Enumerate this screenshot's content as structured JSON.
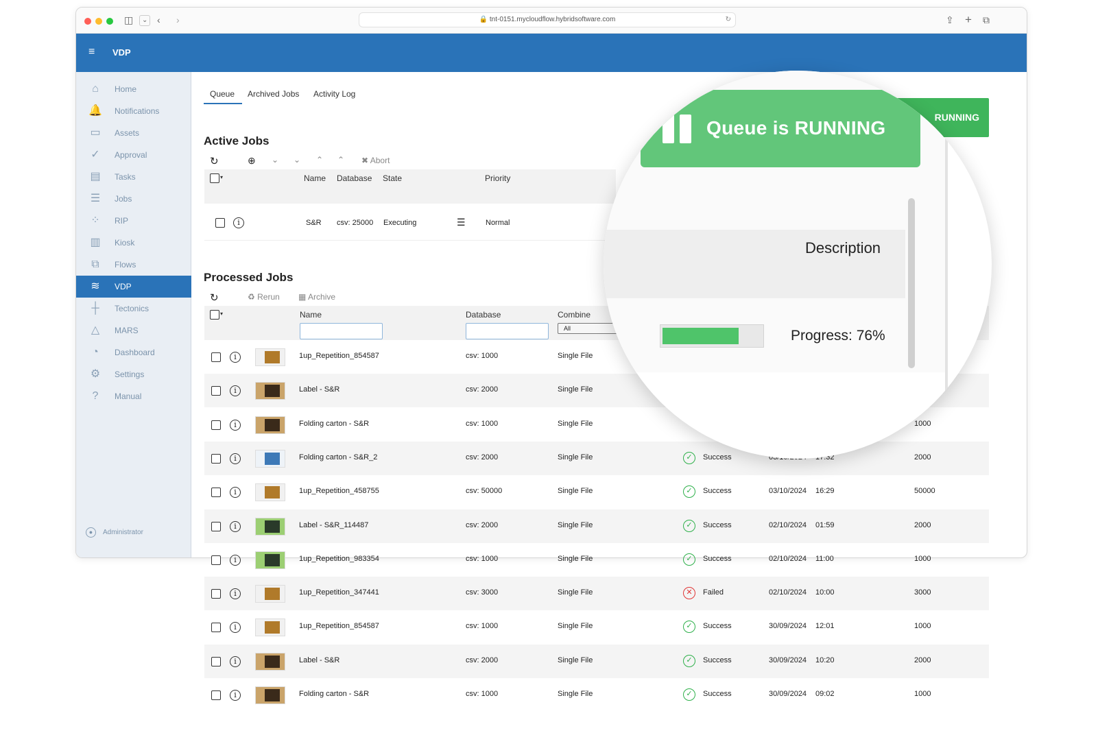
{
  "browser": {
    "url": "tnt-0151.mycloudflow.hybridsoftware.com"
  },
  "app": {
    "title": "VDP",
    "user": "Administrator"
  },
  "sidebar": {
    "items": [
      {
        "label": "Home",
        "icon": "home-icon",
        "glyph": "⌂"
      },
      {
        "label": "Notifications",
        "icon": "bell-icon",
        "glyph": "🔔"
      },
      {
        "label": "Assets",
        "icon": "tray-icon",
        "glyph": "▭"
      },
      {
        "label": "Approval",
        "icon": "check-circle-icon",
        "glyph": "✓"
      },
      {
        "label": "Tasks",
        "icon": "calendar-icon",
        "glyph": "▤"
      },
      {
        "label": "Jobs",
        "icon": "list-icon",
        "glyph": "☰"
      },
      {
        "label": "RIP",
        "icon": "dots-grid-icon",
        "glyph": "⁘"
      },
      {
        "label": "Kiosk",
        "icon": "kiosk-icon",
        "glyph": "▥"
      },
      {
        "label": "Flows",
        "icon": "flows-icon",
        "glyph": "⧉"
      },
      {
        "label": "VDP",
        "icon": "layers-icon",
        "glyph": "≋"
      },
      {
        "label": "Tectonics",
        "icon": "tectonics-icon",
        "glyph": "┼"
      },
      {
        "label": "MARS",
        "icon": "triangle-icon",
        "glyph": "△"
      },
      {
        "label": "Dashboard",
        "icon": "pie-icon",
        "glyph": "◔"
      },
      {
        "label": "Settings",
        "icon": "gear-icon",
        "glyph": "⚙"
      },
      {
        "label": "Manual",
        "icon": "help-icon",
        "glyph": "?"
      }
    ]
  },
  "tabs": [
    "Queue",
    "Archived Jobs",
    "Activity Log"
  ],
  "queue_status": "Queue is RUNNING",
  "queue_status_small": "RUNNING",
  "active": {
    "title": "Active Jobs",
    "abort": "Abort",
    "headers": [
      "Name",
      "Database",
      "State",
      "Priority"
    ],
    "job": {
      "name": "S&R",
      "database": "csv: 25000",
      "state": "Executing",
      "priority": "Normal"
    }
  },
  "zoom": {
    "description": "Description",
    "progress_label": "Progress: 76%",
    "progress": 0.76
  },
  "processed": {
    "title": "Processed Jobs",
    "rerun": "Rerun",
    "archive": "Archive",
    "headers": [
      "Name",
      "Database",
      "Combine"
    ],
    "combine_filter": "All",
    "rows": [
      {
        "name": "1up_Repetition_854587",
        "db": "csv: 1000",
        "combine": "Single File",
        "status": "",
        "date": "",
        "time": "",
        "count": "",
        "thumb": "tall"
      },
      {
        "name": "Label - S&R",
        "db": "csv: 2000",
        "combine": "Single File",
        "status": "",
        "date": "",
        "time": "",
        "count": "",
        "thumb": "label"
      },
      {
        "name": "Folding carton - S&R",
        "db": "csv: 1000",
        "combine": "Single File",
        "status": "",
        "date": "",
        "time": "",
        "count": "1000",
        "thumb": "label"
      },
      {
        "name": "Folding carton - S&R_2",
        "db": "csv: 2000",
        "combine": "Single File",
        "status": "Success",
        "date": "03/10/2024",
        "time": "17:32",
        "count": "2000",
        "thumb": "blue"
      },
      {
        "name": "1up_Repetition_458755",
        "db": "csv: 50000",
        "combine": "Single File",
        "status": "Success",
        "date": "03/10/2024",
        "time": "16:29",
        "count": "50000",
        "thumb": "tall"
      },
      {
        "name": "Label - S&R_114487",
        "db": "csv: 2000",
        "combine": "Single File",
        "status": "Success",
        "date": "02/10/2024",
        "time": "01:59",
        "count": "2000",
        "thumb": "green"
      },
      {
        "name": "1up_Repetition_983354",
        "db": "csv: 1000",
        "combine": "Single File",
        "status": "Success",
        "date": "02/10/2024",
        "time": "11:00",
        "count": "1000",
        "thumb": "green"
      },
      {
        "name": "1up_Repetition_347441",
        "db": "csv: 3000",
        "combine": "Single File",
        "status": "Failed",
        "date": "02/10/2024",
        "time": "10:00",
        "count": "3000",
        "thumb": "tall"
      },
      {
        "name": "1up_Repetition_854587",
        "db": "csv: 1000",
        "combine": "Single File",
        "status": "Success",
        "date": "30/09/2024",
        "time": "12:01",
        "count": "1000",
        "thumb": "tall"
      },
      {
        "name": "Label - S&R",
        "db": "csv: 2000",
        "combine": "Single File",
        "status": "Success",
        "date": "30/09/2024",
        "time": "10:20",
        "count": "2000",
        "thumb": "label"
      },
      {
        "name": "Folding carton - S&R",
        "db": "csv: 1000",
        "combine": "Single File",
        "status": "Success",
        "date": "30/09/2024",
        "time": "09:02",
        "count": "1000",
        "thumb": "label"
      }
    ]
  },
  "colors": {
    "accent": "#2a73b8",
    "success": "#2eb04a",
    "fail": "#e03535",
    "running": "#4fc46a"
  }
}
